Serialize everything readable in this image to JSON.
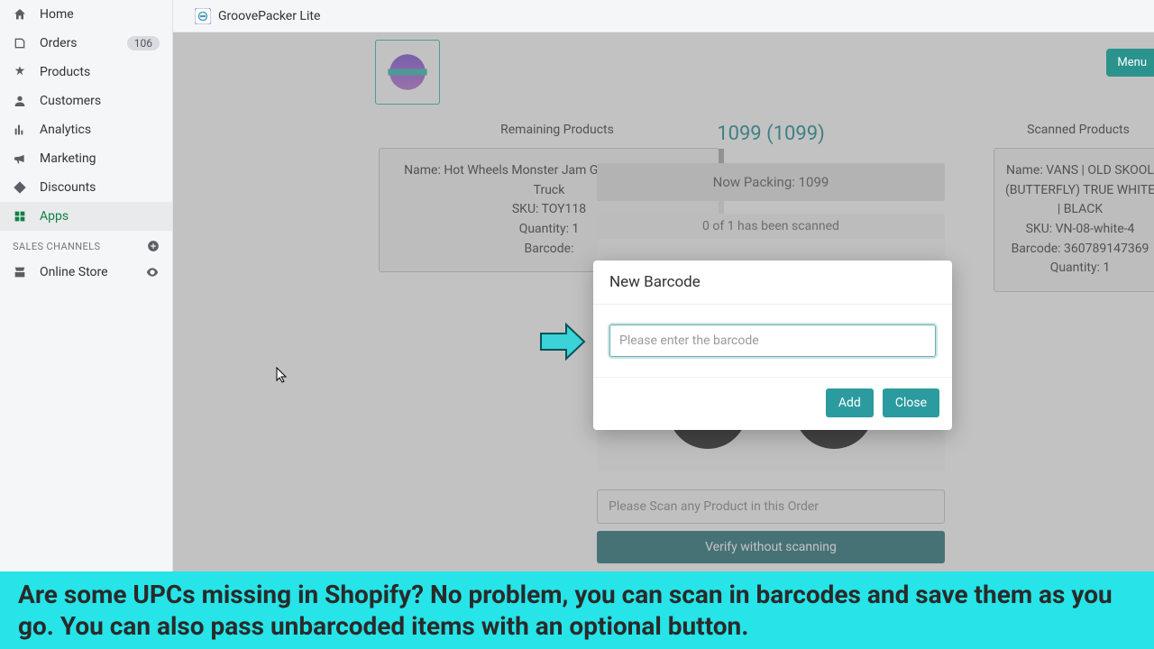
{
  "topbar": {
    "app_name": "GroovePacker Lite"
  },
  "sidebar": {
    "items": [
      {
        "label": "Home"
      },
      {
        "label": "Orders",
        "badge": "106"
      },
      {
        "label": "Products"
      },
      {
        "label": "Customers"
      },
      {
        "label": "Analytics"
      },
      {
        "label": "Marketing"
      },
      {
        "label": "Discounts"
      },
      {
        "label": "Apps"
      }
    ],
    "sales_channels_header": "SALES CHANNELS",
    "online_store": "Online Store"
  },
  "menu_button": "Menu",
  "remaining": {
    "title": "Remaining Products",
    "item": {
      "name": "Name: Hot Wheels Monster Jam Giant Grave Digger Truck",
      "sku": "SKU: TOY118",
      "quantity": "Quantity: 1",
      "barcode": "Barcode:"
    }
  },
  "scanned": {
    "title": "Scanned Products",
    "item": {
      "name": "Name: VANS | OLD SKOOL (BUTTERFLY) TRUE WHITE | BLACK",
      "sku": "SKU: VN-08-white-4",
      "barcode": "Barcode: 360789147369",
      "quantity": "Quantity: 1"
    }
  },
  "center": {
    "order_number": "1099 (1099)",
    "now_packing": "Now Packing: 1099",
    "scanned_status": "0 of 1 has been scanned",
    "scan_placeholder": "Please Scan any Product in this Order",
    "verify_label": "Verify without scanning"
  },
  "modal": {
    "title": "New Barcode",
    "placeholder": "Please enter the barcode",
    "add": "Add",
    "close": "Close"
  },
  "caption": "Are some UPCs missing in Shopify? No problem, you can scan in barcodes and save them as you go. You can also pass unbarcoded items with an optional button."
}
